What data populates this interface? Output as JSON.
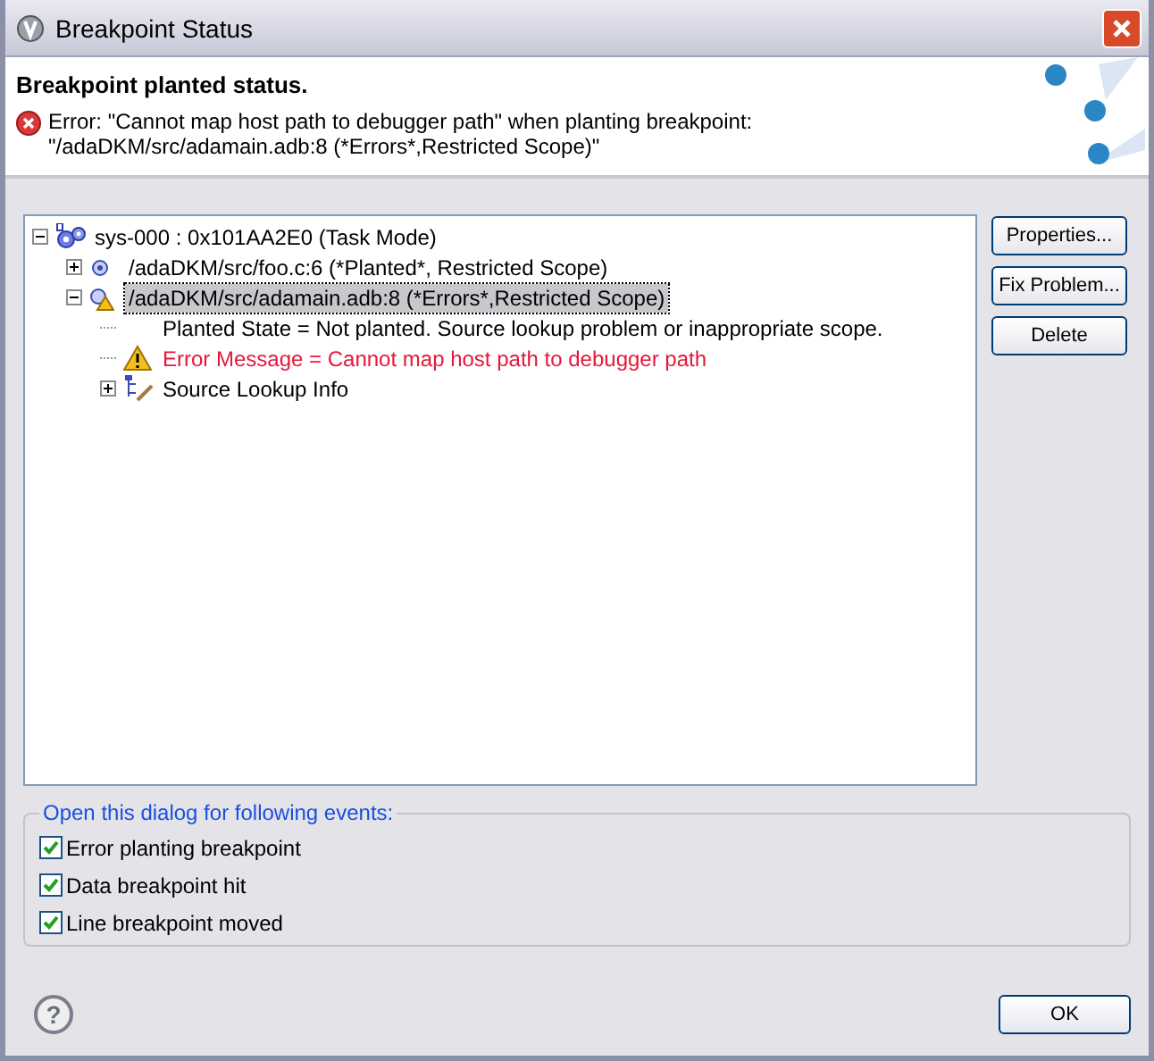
{
  "window": {
    "title": "Breakpoint Status"
  },
  "header": {
    "title": "Breakpoint planted status.",
    "message": "Error: \"Cannot map host path to debugger path\" when planting breakpoint: \"/adaDKM/src/adamain.adb:8 (*Errors*,Restricted Scope)\""
  },
  "tree": [
    {
      "kind": "target",
      "label": "sys-000 : 0x101AA2E0 (Task Mode)",
      "expanded": true,
      "selected": false,
      "children": [
        {
          "kind": "breakpoint",
          "label": "/adaDKM/src/foo.c:6 (*Planted*, Restricted Scope)",
          "expanded": false,
          "selected": false
        },
        {
          "kind": "breakpoint-warning",
          "label": "/adaDKM/src/adamain.adb:8 (*Errors*,Restricted Scope)",
          "expanded": true,
          "selected": true,
          "children": [
            {
              "kind": "info",
              "label": "Planted State = Not planted. Source lookup problem or inappropriate scope.",
              "selected": false
            },
            {
              "kind": "error",
              "label": "Error Message = Cannot map host path to debugger path",
              "selected": false
            },
            {
              "kind": "lookup",
              "label": "Source Lookup Info",
              "expanded": false,
              "selected": false
            }
          ]
        }
      ]
    }
  ],
  "buttons": [
    "Properties...",
    "Fix Problem...",
    "Delete"
  ],
  "events": {
    "title": "Open this dialog for following events:",
    "items": [
      {
        "label": "Error planting breakpoint",
        "checked": true
      },
      {
        "label": "Data breakpoint hit",
        "checked": true
      },
      {
        "label": "Line breakpoint moved",
        "checked": true
      }
    ]
  },
  "footer": {
    "help": "?",
    "ok": "OK"
  }
}
